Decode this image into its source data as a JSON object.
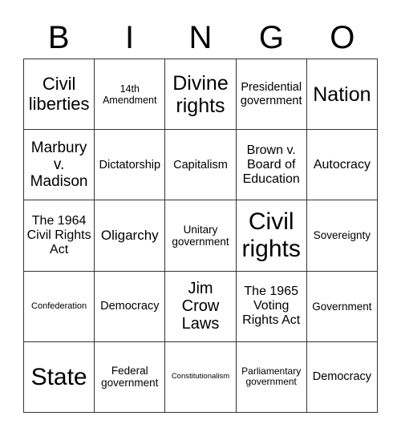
{
  "header": {
    "letters": [
      "B",
      "I",
      "N",
      "G",
      "O"
    ]
  },
  "board": {
    "rows": [
      [
        "Civil liberties",
        "14th Amendment",
        "Divine rights",
        "Presidential government",
        "Nation"
      ],
      [
        "Marbury v. Madison",
        "Dictatorship",
        "Capitalism",
        "Brown v. Board of Education",
        "Autocracy"
      ],
      [
        "The 1964 Civil Rights Act",
        "Oligarchy",
        "Unitary government",
        "Civil rights",
        "Sovereignty"
      ],
      [
        "Confederation",
        "Democracy",
        "Jim Crow Laws",
        "The 1965 Voting Rights Act",
        "Government"
      ],
      [
        "State",
        "Federal government",
        "Constitutionalism",
        "Parliamentary government",
        "Democracy"
      ]
    ]
  }
}
